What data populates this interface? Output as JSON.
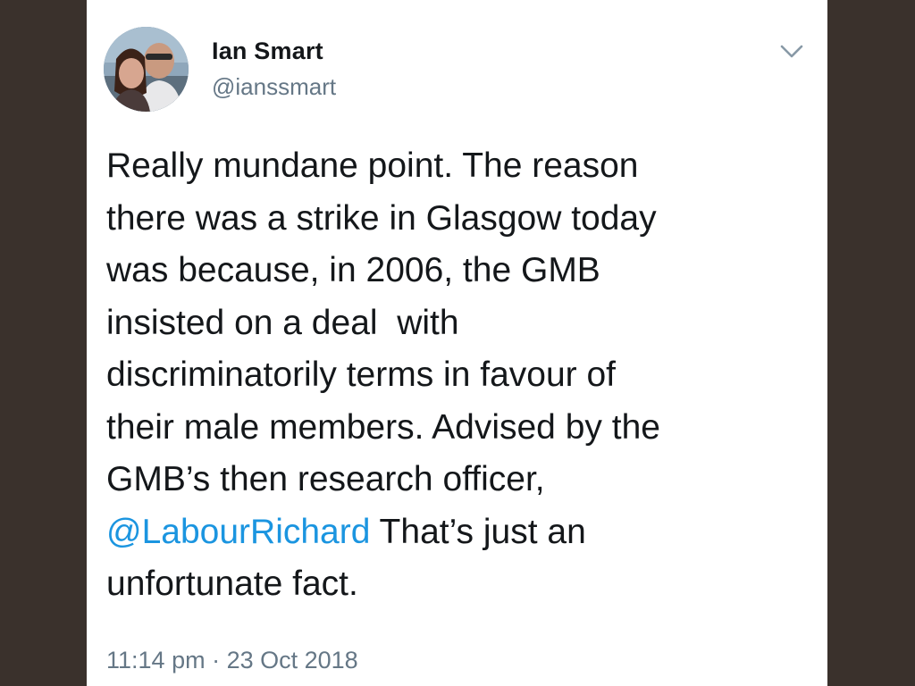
{
  "tweet": {
    "author": {
      "name": "Ian Smart",
      "handle": "@ianssmart"
    },
    "menu_icon": "chevron-down-icon",
    "lines": [
      "Really mundane point. The reason",
      "there was a strike in Glasgow today",
      "was because, in 2006, the GMB",
      "insisted on a deal  with",
      "discriminatorily terms in favour of",
      "their male members. Advised by the",
      "GMB’s then research officer,"
    ],
    "mention": "@LabourRichard",
    "after_mention": " That’s just an",
    "last_line": "unfortunate fact.",
    "time": "11:14 pm",
    "separator": " · ",
    "date": "23 Oct 2018"
  },
  "colors": {
    "background": "#3a312c",
    "card": "#ffffff",
    "text": "#14171a",
    "secondary": "#657786",
    "link": "#1b95e0"
  }
}
